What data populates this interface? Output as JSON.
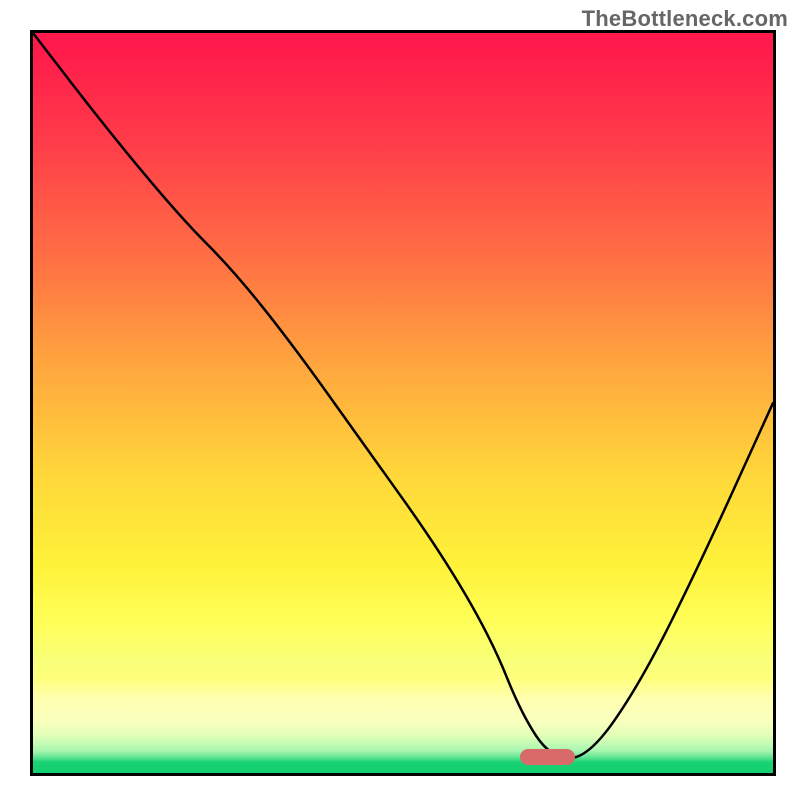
{
  "watermark": "TheBottleneck.com",
  "chart_data": {
    "type": "line",
    "title": "",
    "xlabel": "",
    "ylabel": "",
    "xlim": [
      0,
      1
    ],
    "ylim": [
      0,
      1
    ],
    "grid": false,
    "background": "red-yellow-green vertical gradient",
    "series": [
      {
        "name": "bottleneck-curve",
        "x": [
          0.0,
          0.1,
          0.2,
          0.27,
          0.35,
          0.45,
          0.55,
          0.62,
          0.66,
          0.7,
          0.75,
          0.82,
          0.9,
          1.0
        ],
        "y": [
          1.0,
          0.87,
          0.75,
          0.68,
          0.58,
          0.44,
          0.3,
          0.18,
          0.08,
          0.02,
          0.02,
          0.12,
          0.28,
          0.5
        ]
      }
    ],
    "indicator": {
      "x_center": 0.695,
      "y": 0.022,
      "width": 0.075
    },
    "annotations": []
  }
}
